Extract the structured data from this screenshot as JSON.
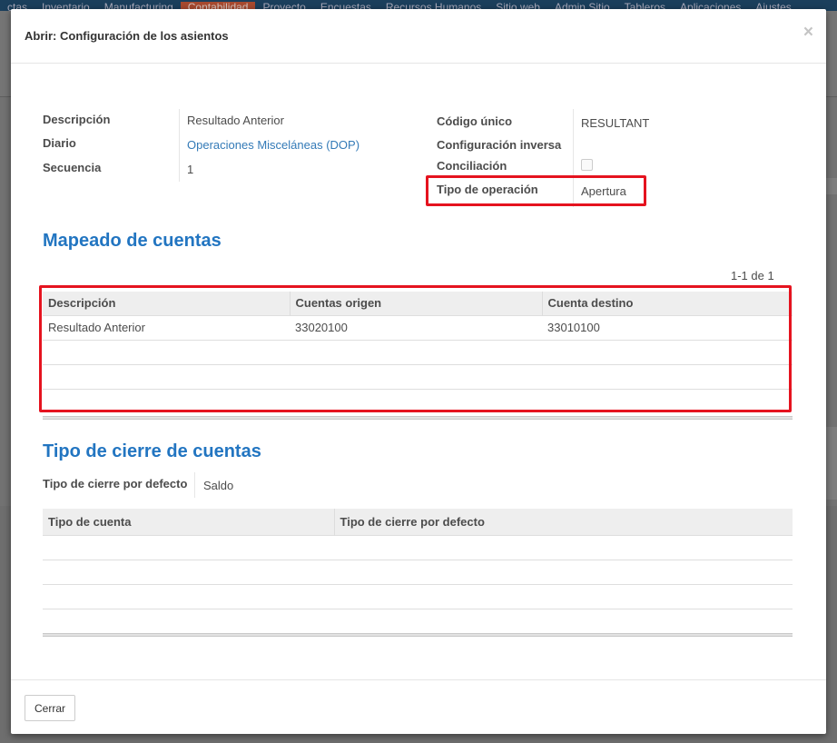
{
  "topbar": {
    "items": [
      "ctas",
      "Inventario",
      "Manufacturing",
      "Contabilidad",
      "Proyecto",
      "Encuestas",
      "Recursos Humanos",
      "Sitio web",
      "Admin Sitio",
      "Tableros",
      "Aplicaciones",
      "Ajustes"
    ],
    "active_index": 3
  },
  "modal": {
    "title": "Abrir: Configuración de los asientos",
    "close_glyph": "×"
  },
  "form": {
    "left": [
      {
        "label": "Descripción",
        "value": "Resultado Anterior"
      },
      {
        "label": "Diario",
        "value": "Operaciones Misceláneas (DOP)"
      },
      {
        "label": "Secuencia",
        "value": "1"
      }
    ],
    "right": [
      {
        "label": "Código único",
        "value": "RESULTANT"
      },
      {
        "label": "Configuración inversa",
        "value": ""
      },
      {
        "label": "Conciliación",
        "checked": false
      },
      {
        "label": "Tipo de operación",
        "value": "Apertura"
      }
    ]
  },
  "mapping": {
    "title": "Mapeado de cuentas",
    "pager": "1-1 de 1",
    "columns": [
      "Descripción",
      "Cuentas origen",
      "Cuenta destino"
    ],
    "rows": [
      [
        "Resultado Anterior",
        "33020100",
        "33010100"
      ]
    ]
  },
  "closing": {
    "title": "Tipo de cierre de cuentas",
    "default_label": "Tipo de cierre por defecto",
    "default_value": "Saldo",
    "columns": [
      "Tipo de cuenta",
      "Tipo de cierre por defecto"
    ]
  },
  "footer": {
    "close_label": "Cerrar"
  },
  "colors": {
    "accent": "#2275c1",
    "highlight": "#e5131f",
    "link": "#337ab7",
    "menu_active": "#a84a2f"
  }
}
